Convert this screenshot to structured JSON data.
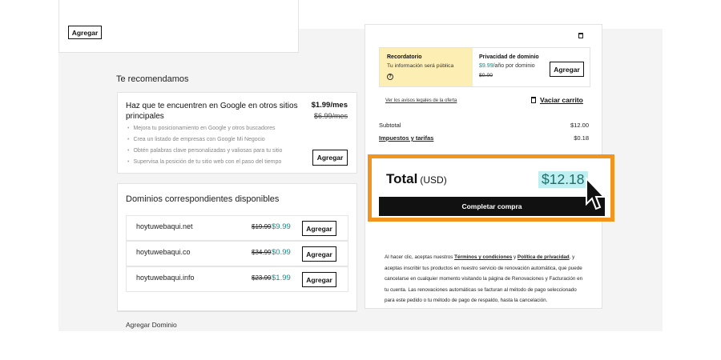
{
  "top_card": {
    "add_label": "Agregar"
  },
  "recommend": {
    "heading": "Te recomendamos",
    "google": {
      "title": "Haz que te encuentren en Google en otros sitios principales",
      "price": "$1.99/mes",
      "old_price": "$6.99/mes",
      "bullets": [
        "Mejora tu posicionamiento en Google y otros buscadores",
        "Crea un listado de empresas con Google Mi Negocio",
        "Obtén palabras clave personalizadas y valiosas para tu sitio",
        "Supervisa la posición de tu sitio web con el paso del tiempo"
      ],
      "add_label": "Agregar"
    },
    "domains": {
      "title": "Dominios correspondientes disponibles",
      "items": [
        {
          "name": "hoytuwebaqui.net",
          "old_price": "$19.99",
          "price": "$9.99",
          "add_label": "Agregar"
        },
        {
          "name": "hoytuwebaqui.co",
          "old_price": "$34.99",
          "price": "$0.99",
          "add_label": "Agregar"
        },
        {
          "name": "hoytuwebaqui.info",
          "old_price": "$23.99",
          "price": "$1.99",
          "add_label": "Agregar"
        }
      ]
    },
    "add_domain": "Agregar Dominio"
  },
  "cart": {
    "reminder_title": "Recordatorio",
    "reminder_text": "Tu información será pública",
    "privacy_title": "Privacidad de dominio",
    "privacy_price": "$9.99",
    "privacy_period": "/año por dominio",
    "privacy_old": "$0.00",
    "privacy_add": "Agregar",
    "legal_link": "Ver los avisos legales de la oferta",
    "empty_cart": "Vaciar carrito",
    "subtotal_label": "Subtotal",
    "subtotal_value": "$12.00",
    "taxes_label": "Impuestos y tarifas",
    "taxes_value": "$0.18",
    "total_label": "Total",
    "total_currency": "(USD)",
    "total_value": "$12.18",
    "checkout_label": "Completar compra",
    "terms_pre": "Al hacer clic, aceptas nuestros ",
    "terms_link": "Términos y condiciones",
    "terms_mid": " y ",
    "privacy_link": "Política de privacidad",
    "terms_post": ", y aceptas inscribir tus productos en nuestro servicio de renovación automática, que puede cancelarse en cualquier momento visitando la página de Renovaciones y Facturación en tu cuenta. Las renovaciones automáticas se facturan al método de pago seleccionado para este pedido o tu método de pago de respaldo, hasta la cancelación."
  },
  "icons": {
    "trash": "trash-icon",
    "cart": "cart-icon",
    "info": "info-icon",
    "cursor": "cursor-icon"
  },
  "colors": {
    "accent_teal": "#1d8a85",
    "highlight_orange": "#f2951f",
    "reminder_yellow": "#fdeeb4"
  }
}
